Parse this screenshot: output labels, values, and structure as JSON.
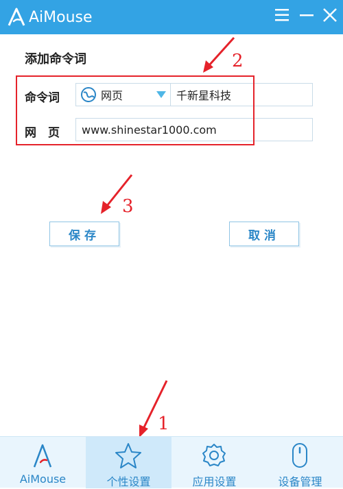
{
  "app": {
    "title": "AiMouse"
  },
  "form": {
    "section_title": "添加命令词",
    "command_label": "命令词",
    "command_type": "网页",
    "command_value": "千新星科技",
    "web_label": "网　页",
    "web_value": "www.shinestar1000.com"
  },
  "buttons": {
    "save": "保存",
    "cancel": "取消"
  },
  "annotations": {
    "a1": "1",
    "a2": "2",
    "a3": "3"
  },
  "tabs": [
    {
      "label": "AiMouse",
      "icon": "aimouse-logo-icon",
      "active": false
    },
    {
      "label": "个性设置",
      "icon": "star-icon",
      "active": true
    },
    {
      "label": "应用设置",
      "icon": "gear-icon",
      "active": false
    },
    {
      "label": "设备管理",
      "icon": "mouse-icon",
      "active": false
    }
  ],
  "colors": {
    "header": "#33a3e4",
    "accent": "#2a86c7",
    "annotation": "#e5222a",
    "tab_active_bg": "#cfe9fa",
    "tab_bar_bg": "#e9f5fd"
  }
}
